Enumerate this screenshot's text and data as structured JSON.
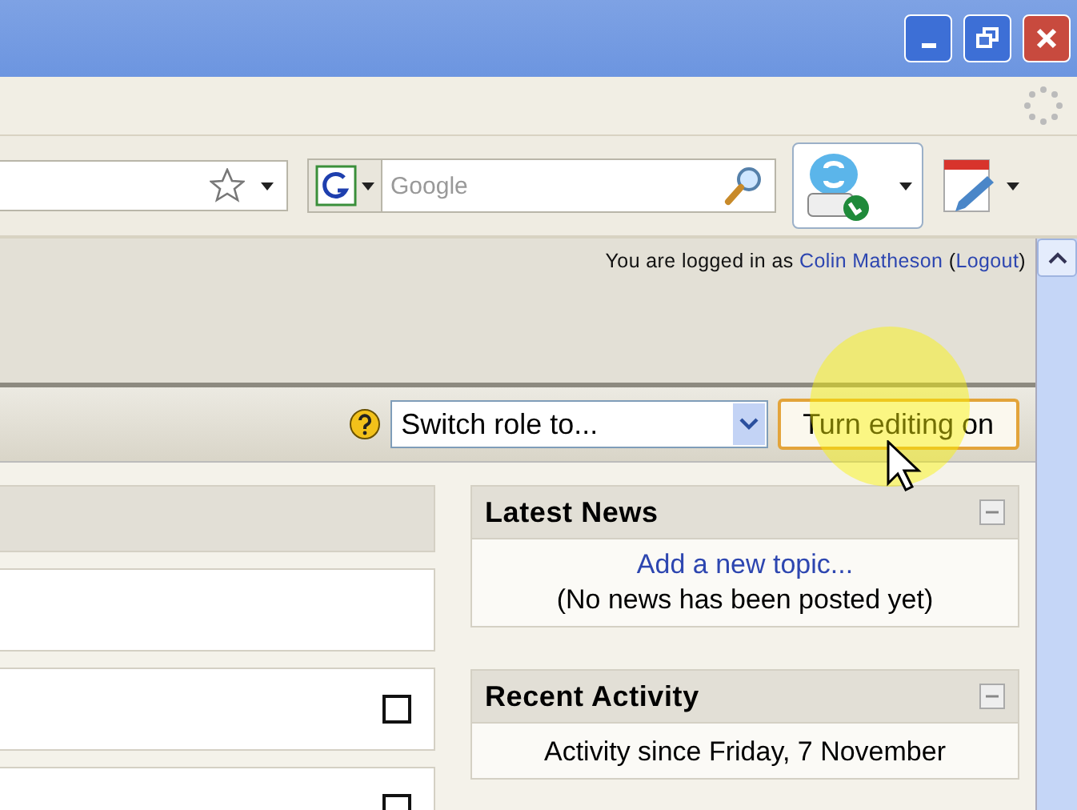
{
  "browser": {
    "search": {
      "placeholder": "Google"
    }
  },
  "header": {
    "login": {
      "prefix": "You are logged in as",
      "user_link": "Colin Matheson",
      "open": "(",
      "logout_link": "Logout",
      "close": ")"
    }
  },
  "navbar": {
    "role_select": {
      "value": "Switch role to..."
    },
    "edit_button": {
      "label": "Turn editing on",
      "highlighted": true
    }
  },
  "left_column": {
    "boxes": [
      {
        "kind": "header"
      },
      {
        "kind": "plain"
      },
      {
        "kind": "checkbox",
        "checked": false
      },
      {
        "kind": "checkbox",
        "checked": false
      }
    ]
  },
  "blocks": [
    {
      "title": "Latest News",
      "lines": [
        {
          "kind": "link",
          "text": "Add a new topic..."
        },
        {
          "kind": "note",
          "text": "(No news has been posted yet)"
        }
      ]
    },
    {
      "title": "Recent Activity",
      "lines": [
        {
          "kind": "note",
          "text": "Activity since Friday, 7 November"
        }
      ]
    }
  ]
}
